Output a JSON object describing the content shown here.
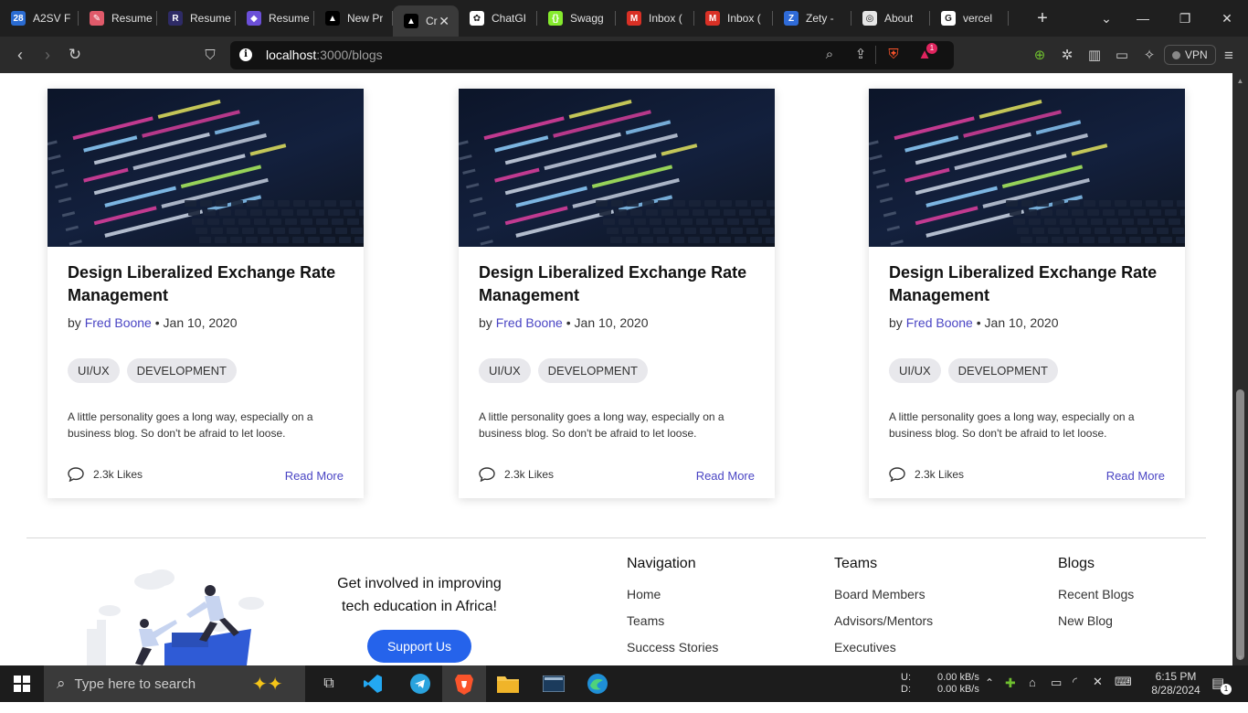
{
  "browser": {
    "tabs": [
      {
        "title": "A2SV F",
        "color": "#2a6bd1",
        "glyph": "28"
      },
      {
        "title": "Resume",
        "color": "#e05a6a",
        "glyph": "✎"
      },
      {
        "title": "Resume",
        "color": "#2e2b66",
        "glyph": "R"
      },
      {
        "title": "Resume",
        "color": "#6b4fd8",
        "glyph": "◆"
      },
      {
        "title": "New Pr",
        "color": "#000000",
        "glyph": "▲"
      },
      {
        "title": "Cr",
        "color": "#000000",
        "glyph": "▲",
        "active": true
      },
      {
        "title": "ChatGI",
        "color": "#ffffff",
        "glyph": "✿"
      },
      {
        "title": "Swagg",
        "color": "#85ea2d",
        "glyph": "{}"
      },
      {
        "title": "Inbox (",
        "color": "#d93025",
        "glyph": "M"
      },
      {
        "title": "Inbox (",
        "color": "#d93025",
        "glyph": "M"
      },
      {
        "title": "Zety -",
        "color": "#2f6bd8",
        "glyph": "Z"
      },
      {
        "title": "About",
        "color": "#e6e6e6",
        "glyph": "◎"
      },
      {
        "title": "vercel",
        "color": "#ffffff",
        "glyph": "G"
      }
    ],
    "url_host": "localhost",
    "url_path": ":3000/blogs",
    "vpn_label": "VPN",
    "rewards_badge": "1"
  },
  "blog_cards": [
    {
      "title": "Design Liberalized Exchange Rate Management",
      "by": "by",
      "author": "Fred Boone",
      "date": "• Jan 10, 2020",
      "tags": [
        "UI/UX",
        "DEVELOPMENT"
      ],
      "description": "A little personality goes a long way, especially on a business blog. So don't be afraid to let loose.",
      "likes": "2.3k Likes",
      "read_more": "Read More"
    },
    {
      "title": "Design Liberalized Exchange Rate Management",
      "by": "by",
      "author": "Fred Boone",
      "date": "• Jan 10, 2020",
      "tags": [
        "UI/UX",
        "DEVELOPMENT"
      ],
      "description": "A little personality goes a long way, especially on a business blog. So don't be afraid to let loose.",
      "likes": "2.3k Likes",
      "read_more": "Read More"
    },
    {
      "title": "Design Liberalized Exchange Rate Management",
      "by": "by",
      "author": "Fred Boone",
      "date": "• Jan 10, 2020",
      "tags": [
        "UI/UX",
        "DEVELOPMENT"
      ],
      "description": "A little personality goes a long way, especially on a business blog. So don't be afraid to let loose.",
      "likes": "2.3k Likes",
      "read_more": "Read More"
    }
  ],
  "footer": {
    "cta_line1": "Get involved in improving",
    "cta_line2": "tech education in Africa!",
    "support_button": "Support Us",
    "columns": [
      {
        "heading": "Navigation",
        "links": [
          "Home",
          "Teams",
          "Success Stories"
        ]
      },
      {
        "heading": "Teams",
        "links": [
          "Board Members",
          "Advisors/Mentors",
          "Executives"
        ]
      },
      {
        "heading": "Blogs",
        "links": [
          "Recent Blogs",
          "New Blog"
        ]
      }
    ]
  },
  "taskbar": {
    "search_placeholder": "Type here to search",
    "net_up_label": "U:",
    "net_down_label": "D:",
    "net_up": "0.00 kB/s",
    "net_down": "0.00 kB/s",
    "time": "6:15 PM",
    "date": "8/28/2024",
    "notification_count": "1"
  }
}
